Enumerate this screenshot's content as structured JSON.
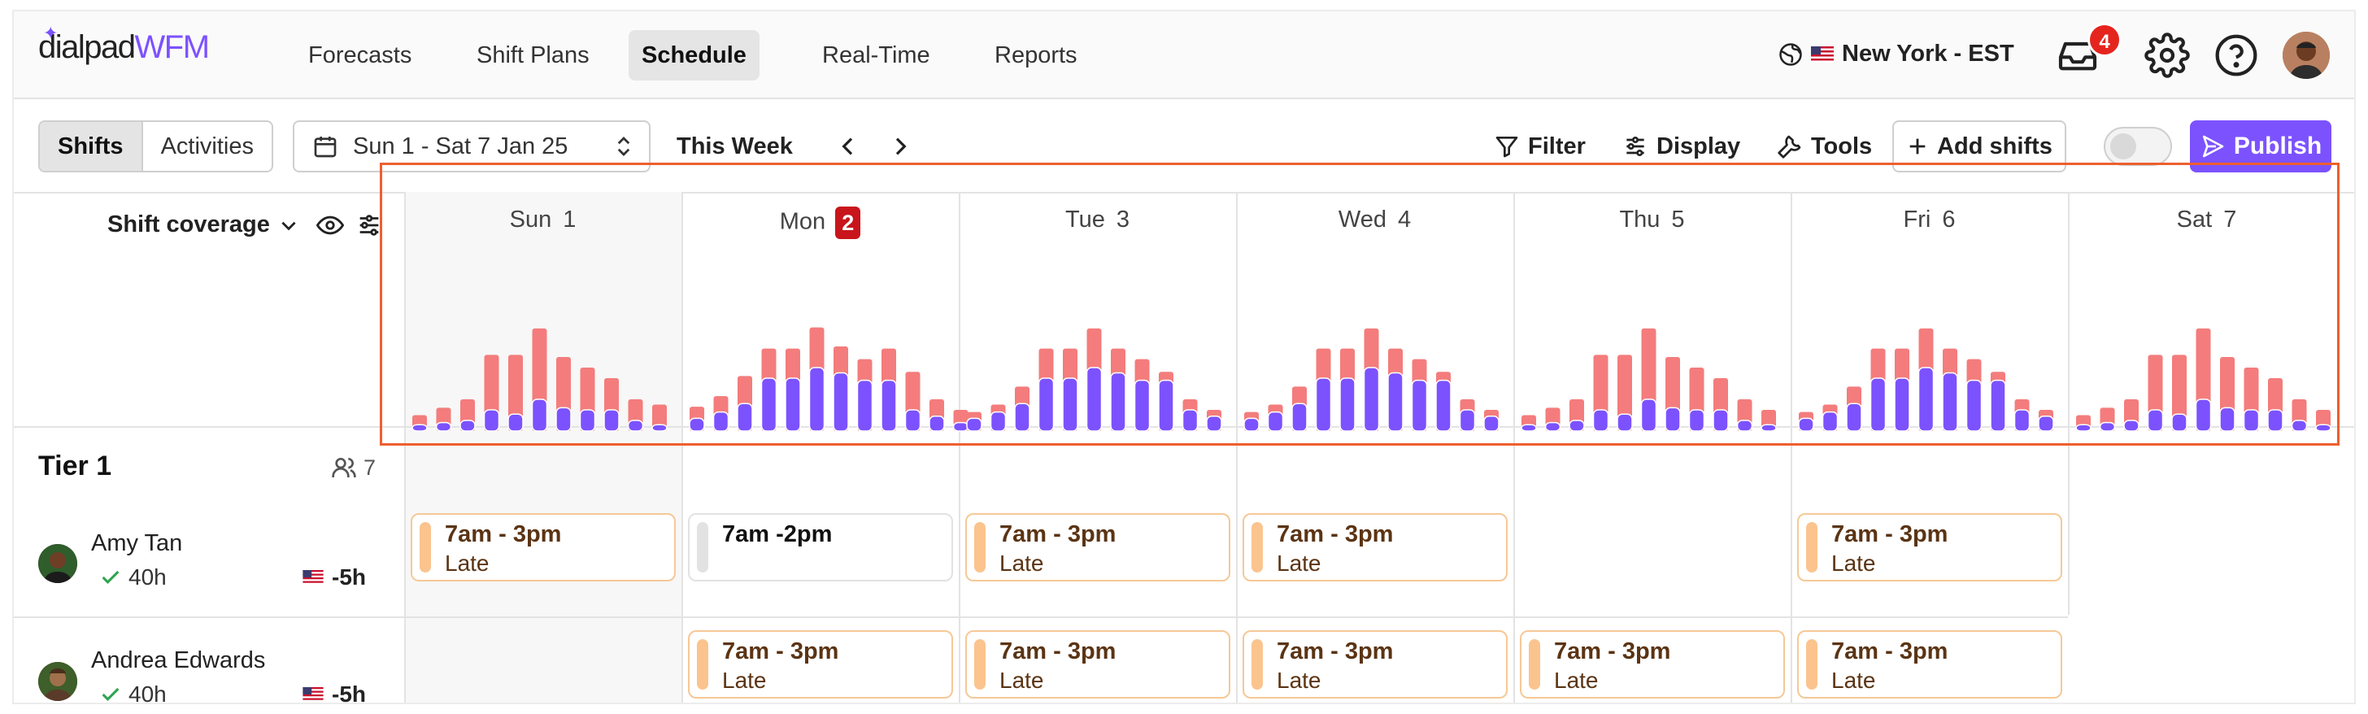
{
  "brand": {
    "name": "dialpad",
    "product": "WFM"
  },
  "nav": {
    "tabs": [
      {
        "label": "Forecasts",
        "active": false
      },
      {
        "label": "Shift Plans",
        "active": false
      },
      {
        "label": "Schedule",
        "active": true
      },
      {
        "label": "Real-Time",
        "active": false
      },
      {
        "label": "Reports",
        "active": false
      }
    ],
    "timezone": "New York - EST",
    "notifications_count": "4"
  },
  "toolbar": {
    "view_options": [
      "Shifts",
      "Activities"
    ],
    "active_view": "Shifts",
    "date_range": "Sun 1 - Sat 7 Jan 25",
    "this_week": "This Week",
    "filter": "Filter",
    "display": "Display",
    "tools": "Tools",
    "add_shifts": "Add shifts",
    "publish": "Publish",
    "toggle_on": false
  },
  "coverage": {
    "label": "Shift coverage"
  },
  "days": [
    {
      "name": "Sun",
      "num": "1",
      "today": false
    },
    {
      "name": "Mon",
      "num": "2",
      "today": true
    },
    {
      "name": "Tue",
      "num": "3",
      "today": false
    },
    {
      "name": "Wed",
      "num": "4",
      "today": false
    },
    {
      "name": "Thu",
      "num": "5",
      "today": false
    },
    {
      "name": "Fri",
      "num": "6",
      "today": false
    },
    {
      "name": "Sat",
      "num": "7",
      "today": false
    }
  ],
  "chart_data": {
    "type": "bar",
    "series": [
      {
        "color": "#f47c7c",
        "values": [
          [
            0.15,
            0.22,
            0.3,
            0.72,
            0.72,
            0.97,
            0.7,
            0.6,
            0.5,
            0.3,
            0.25
          ],
          [
            0.23,
            0.33,
            0.52,
            0.78,
            0.78,
            0.98,
            0.8,
            0.68,
            0.78,
            0.56,
            0.3,
            0.2
          ],
          [
            0.18,
            0.25,
            0.42,
            0.78,
            0.78,
            0.97,
            0.78,
            0.68,
            0.56,
            0.3,
            0.2
          ],
          [
            0.18,
            0.25,
            0.42,
            0.78,
            0.78,
            0.97,
            0.78,
            0.68,
            0.56,
            0.3,
            0.2
          ],
          [
            0.15,
            0.22,
            0.3,
            0.72,
            0.72,
            0.97,
            0.7,
            0.6,
            0.5,
            0.3,
            0.2
          ],
          [
            0.18,
            0.25,
            0.42,
            0.78,
            0.78,
            0.97,
            0.78,
            0.68,
            0.56,
            0.3,
            0.2
          ],
          [
            0.15,
            0.22,
            0.3,
            0.72,
            0.72,
            0.97,
            0.7,
            0.6,
            0.5,
            0.3,
            0.2
          ]
        ]
      },
      {
        "color": "#7c52ff",
        "values": [
          [
            0.06,
            0.08,
            0.1,
            0.2,
            0.16,
            0.3,
            0.22,
            0.2,
            0.2,
            0.1,
            0.06
          ],
          [
            0.12,
            0.18,
            0.26,
            0.5,
            0.5,
            0.6,
            0.55,
            0.48,
            0.48,
            0.2,
            0.14,
            0.08
          ],
          [
            0.12,
            0.18,
            0.26,
            0.5,
            0.5,
            0.6,
            0.55,
            0.48,
            0.48,
            0.2,
            0.14
          ],
          [
            0.12,
            0.18,
            0.26,
            0.5,
            0.5,
            0.6,
            0.55,
            0.48,
            0.48,
            0.2,
            0.14
          ],
          [
            0.06,
            0.08,
            0.1,
            0.2,
            0.16,
            0.3,
            0.22,
            0.2,
            0.2,
            0.1,
            0.06
          ],
          [
            0.12,
            0.18,
            0.26,
            0.5,
            0.5,
            0.6,
            0.55,
            0.48,
            0.48,
            0.2,
            0.14
          ],
          [
            0.06,
            0.08,
            0.1,
            0.2,
            0.16,
            0.3,
            0.22,
            0.2,
            0.2,
            0.1,
            0.06
          ]
        ]
      }
    ]
  },
  "team": {
    "name": "Tier 1",
    "member_count": "7",
    "members": [
      {
        "name": "Amy Tan",
        "hours": "40h",
        "offset": "-5h",
        "shifts": [
          {
            "day": 0,
            "time": "7am - 3pm",
            "label": "Late",
            "style": "orange"
          },
          {
            "day": 1,
            "time": "7am -2pm",
            "label": "",
            "style": "grey"
          },
          {
            "day": 2,
            "time": "7am - 3pm",
            "label": "Late",
            "style": "orange"
          },
          {
            "day": 3,
            "time": "7am - 3pm",
            "label": "Late",
            "style": "orange"
          },
          {
            "day": 5,
            "time": "7am - 3pm",
            "label": "Late",
            "style": "orange"
          }
        ]
      },
      {
        "name": "Andrea Edwards",
        "hours": "40h",
        "offset": "-5h",
        "shifts": [
          {
            "day": 1,
            "time": "7am - 3pm",
            "label": "Late",
            "style": "orange"
          },
          {
            "day": 2,
            "time": "7am - 3pm",
            "label": "Late",
            "style": "orange"
          },
          {
            "day": 3,
            "time": "7am - 3pm",
            "label": "Late",
            "style": "orange"
          },
          {
            "day": 4,
            "time": "7am - 3pm",
            "label": "Late",
            "style": "orange"
          },
          {
            "day": 5,
            "time": "7am - 3pm",
            "label": "Late",
            "style": "orange"
          }
        ]
      }
    ]
  }
}
